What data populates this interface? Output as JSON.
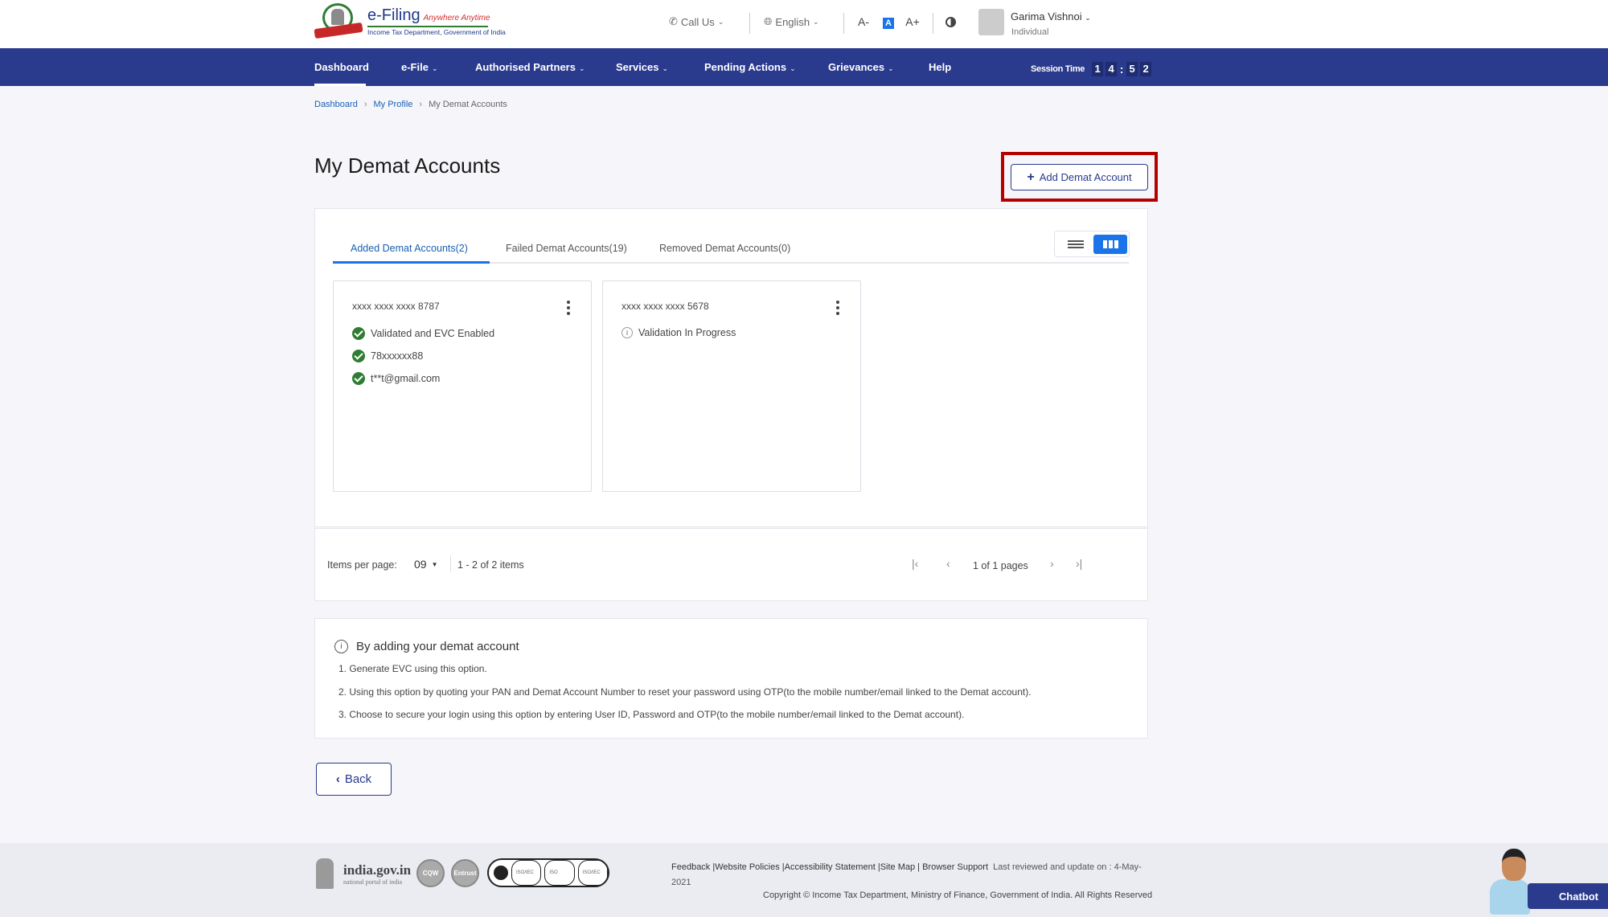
{
  "header": {
    "logo": {
      "title": "e-Filing",
      "tagline": "Anywhere Anytime",
      "subtitle": "Income Tax Department, Government of India"
    },
    "call_us": "Call Us",
    "language": "English",
    "font_controls": [
      "A-",
      "A",
      "A+"
    ],
    "user": {
      "name": "Garima Vishnoi",
      "role": "Individual"
    }
  },
  "nav": {
    "items": [
      {
        "label": "Dashboard",
        "dropdown": false,
        "active": true
      },
      {
        "label": "e-File",
        "dropdown": true
      },
      {
        "label": "Authorised Partners",
        "dropdown": true
      },
      {
        "label": "Services",
        "dropdown": true
      },
      {
        "label": "Pending Actions",
        "dropdown": true
      },
      {
        "label": "Grievances",
        "dropdown": true
      },
      {
        "label": "Help",
        "dropdown": false
      }
    ],
    "session": {
      "label": "Session Time",
      "digits": [
        "1",
        "4",
        "5",
        "2"
      ],
      "separator": ":"
    }
  },
  "breadcrumb": [
    "Dashboard",
    "My Profile",
    "My Demat Accounts"
  ],
  "page": {
    "title": "My Demat Accounts",
    "add_button": "Add Demat Account"
  },
  "tabs": [
    {
      "label": "Added Demat Accounts(2)",
      "active": true
    },
    {
      "label": "Failed Demat Accounts(19)",
      "active": false
    },
    {
      "label": "Removed Demat Accounts(0)",
      "active": false
    }
  ],
  "view_toggle": {
    "options": [
      "list-view",
      "grid-view"
    ],
    "selected": "grid-view"
  },
  "accounts": [
    {
      "number": "xxxx xxxx xxxx 8787",
      "details": [
        {
          "status": "success",
          "text": "Validated and EVC Enabled"
        },
        {
          "status": "success",
          "text": "78xxxxxx88"
        },
        {
          "status": "success",
          "text": "t**t@gmail.com"
        }
      ]
    },
    {
      "number": "xxxx xxxx xxxx 5678",
      "details": [
        {
          "status": "info",
          "text": "Validation In Progress"
        }
      ]
    }
  ],
  "pagination": {
    "items_per_page_label": "Items per page:",
    "items_per_page": "09",
    "range": "1 - 2 of 2 items",
    "pages": "1 of 1 pages"
  },
  "info": {
    "heading": "By adding your demat account",
    "lines": [
      "1. Generate EVC using this option.",
      "2. Using this option by quoting your PAN and Demat Account Number to reset your password using OTP(to the mobile number/email linked to the Demat account).",
      "3. Choose to secure your login using this option by entering User ID, Password and OTP(to the mobile number/email linked to the Demat account)."
    ]
  },
  "back_button": "Back",
  "footer": {
    "india_gov": "india.gov.in",
    "india_gov_sub": "national portal of india",
    "badges": [
      "CQW",
      "Entrust"
    ],
    "links": [
      "Feedback",
      "Website Policies",
      "Accessibility Statement",
      "Site Map",
      "Browser Support"
    ],
    "last_reviewed": "Last reviewed and update on : 4-May-2021",
    "copyright": "Copyright © Income Tax Department, Ministry of Finance, Government of India. All Rights Reserved"
  },
  "chatbot": "Chatbot",
  "colors": {
    "primary": "#2a3a8c",
    "accent": "#1a73e8",
    "success": "#2e7d32",
    "highlight": "#b50000"
  }
}
